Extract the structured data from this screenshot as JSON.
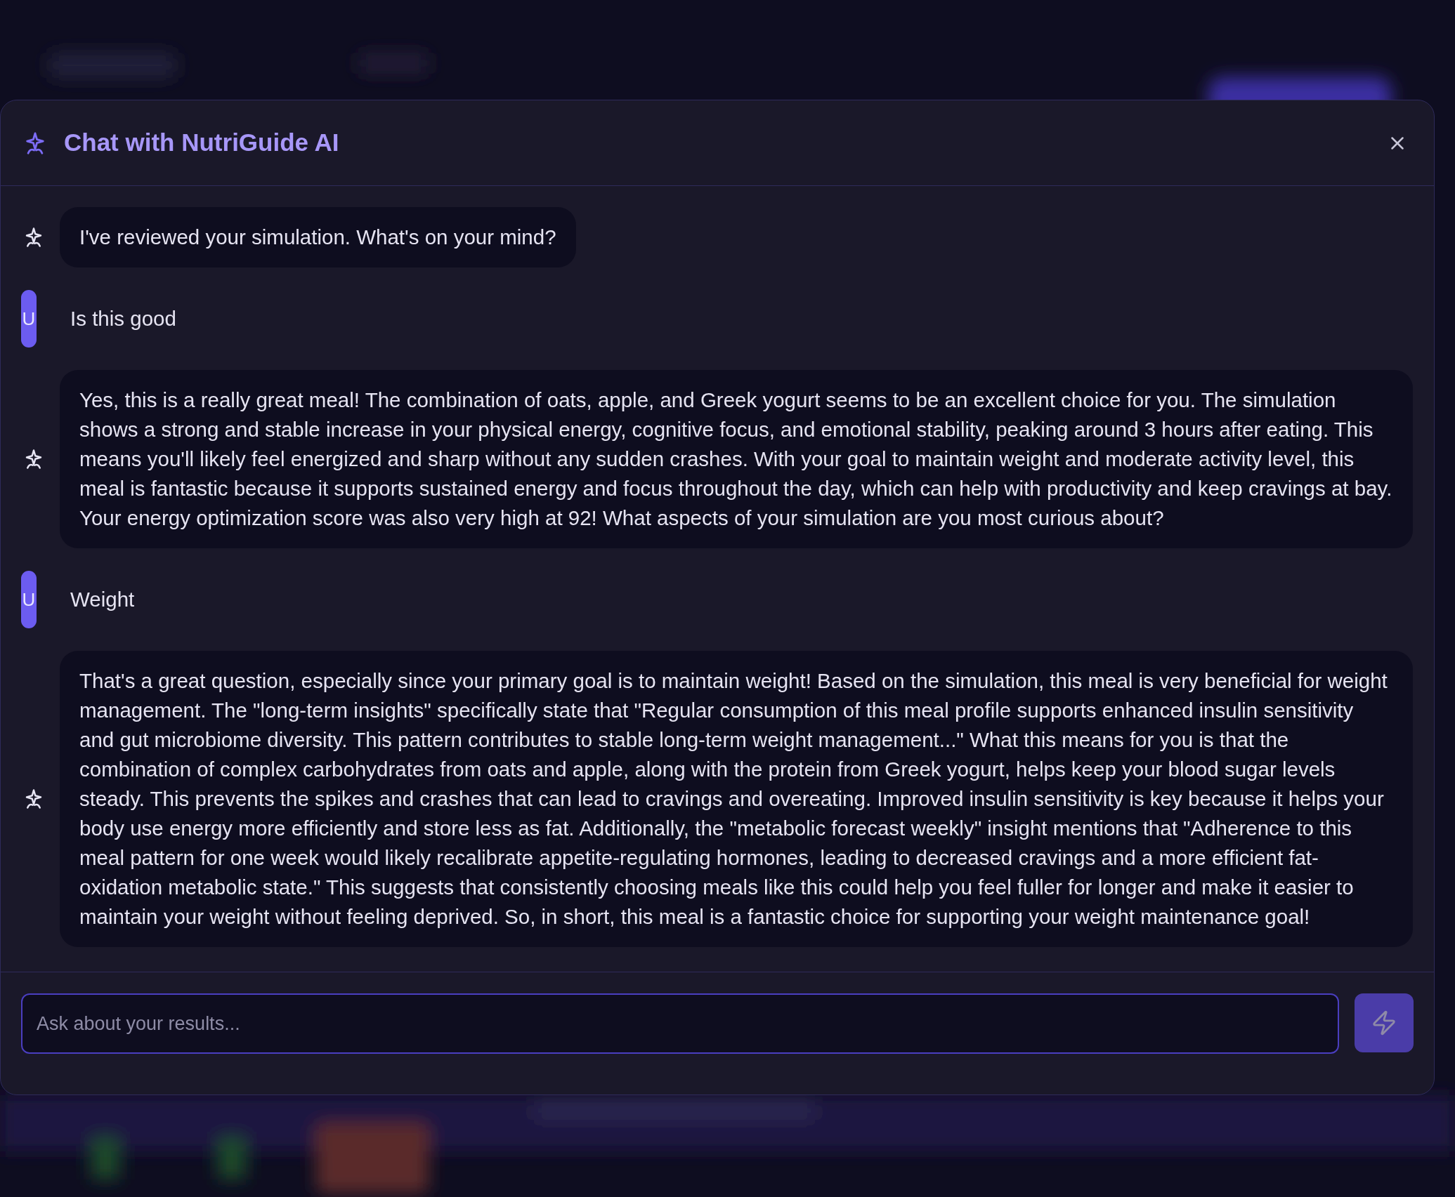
{
  "dialog": {
    "title": "Chat with NutriGuide AI"
  },
  "messages": [
    {
      "kind": "assistant",
      "text": "I've reviewed your simulation. What's on your mind?"
    },
    {
      "kind": "user",
      "avatar": "U",
      "text": "Is this good"
    },
    {
      "kind": "assistant",
      "text": "Yes, this is a really great meal! The combination of oats, apple, and Greek yogurt seems to be an excellent choice for you. The simulation shows a strong and stable increase in your physical energy, cognitive focus, and emotional stability, peaking around 3 hours after eating. This means you'll likely feel energized and sharp without any sudden crashes. With your goal to maintain weight and moderate activity level, this meal is fantastic because it supports sustained energy and focus throughout the day, which can help with productivity and keep cravings at bay. Your energy optimization score was also very high at 92! What aspects of your simulation are you most curious about?"
    },
    {
      "kind": "user",
      "avatar": "U",
      "text": "Weight"
    },
    {
      "kind": "assistant",
      "text": "That's a great question, especially since your primary goal is to maintain weight! Based on the simulation, this meal is very beneficial for weight management. The \"long-term insights\" specifically state that \"Regular consumption of this meal profile supports enhanced insulin sensitivity and gut microbiome diversity. This pattern contributes to stable long-term weight management...\" What this means for you is that the combination of complex carbohydrates from oats and apple, along with the protein from Greek yogurt, helps keep your blood sugar levels steady. This prevents the spikes and crashes that can lead to cravings and overeating. Improved insulin sensitivity is key because it helps your body use energy more efficiently and store less as fat. Additionally, the \"metabolic forecast weekly\" insight mentions that \"Adherence to this meal pattern for one week would likely recalibrate appetite-regulating hormones, leading to decreased cravings and a more efficient fat-oxidation metabolic state.\" This suggests that consistently choosing meals like this could help you feel fuller for longer and make it easier to maintain your weight without feeling deprived. So, in short, this meal is a fantastic choice for supporting your weight maintenance goal!"
    }
  ],
  "input": {
    "placeholder": "Ask about your results..."
  }
}
